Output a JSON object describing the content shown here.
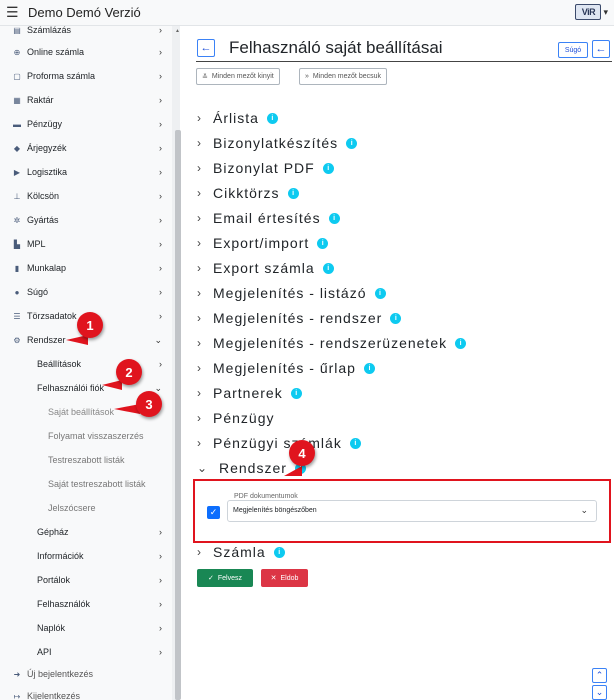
{
  "header": {
    "title": "Demo Demó Verzió",
    "brand": "ViR",
    "menu_icon": "hamburger-icon"
  },
  "sidebar": {
    "items": [
      {
        "label": "Számlázás",
        "icon": "invoice-icon"
      },
      {
        "label": "Online számla",
        "icon": "globe-icon"
      },
      {
        "label": "Proforma számla",
        "icon": "document-icon"
      },
      {
        "label": "Raktár",
        "icon": "warehouse-icon"
      },
      {
        "label": "Pénzügy",
        "icon": "money-icon"
      },
      {
        "label": "Árjegyzék",
        "icon": "tag-icon"
      },
      {
        "label": "Logisztika",
        "icon": "truck-icon"
      },
      {
        "label": "Kölcsön",
        "icon": "lend-icon"
      },
      {
        "label": "Gyártás",
        "icon": "cogs-icon"
      },
      {
        "label": "MPL",
        "icon": "chart-icon"
      },
      {
        "label": "Munkalap",
        "icon": "file-icon"
      },
      {
        "label": "Súgó",
        "icon": "question-icon"
      },
      {
        "label": "Törzsadatok",
        "icon": "database-icon"
      },
      {
        "label": "Rendszer",
        "icon": "settings-icon"
      },
      {
        "label": "Beállítások"
      },
      {
        "label": "Felhasználói fiók"
      },
      {
        "label": "Saját beállítások"
      },
      {
        "label": "Folyamat visszaszerzés"
      },
      {
        "label": "Testreszabott listák"
      },
      {
        "label": "Saját testreszabott listák"
      },
      {
        "label": "Jelszócsere"
      },
      {
        "label": "Gépház"
      },
      {
        "label": "Információk"
      },
      {
        "label": "Portálok"
      },
      {
        "label": "Felhasználók"
      },
      {
        "label": "Naplók"
      },
      {
        "label": "API"
      },
      {
        "label": "Új bejelentkezés",
        "icon": "login-icon"
      },
      {
        "label": "Kijelentkezés",
        "icon": "logout-icon"
      }
    ]
  },
  "main": {
    "title": "Felhasználó saját beállításai",
    "help_label": "Súgó",
    "expand_all": "Minden mezőt kinyit",
    "collapse_all": "Minden mezőt becsuk",
    "sections": [
      {
        "label": "Árlista",
        "info": true
      },
      {
        "label": "Bizonylatkészítés",
        "info": true
      },
      {
        "label": "Bizonylat PDF",
        "info": true
      },
      {
        "label": "Cikktörzs",
        "info": true
      },
      {
        "label": "Email értesítés",
        "info": true
      },
      {
        "label": "Export/import",
        "info": true
      },
      {
        "label": "Export számla",
        "info": true
      },
      {
        "label": "Megjelenítés - listázó",
        "info": true
      },
      {
        "label": "Megjelenítés - rendszer",
        "info": true
      },
      {
        "label": "Megjelenítés - rendszerüzenetek",
        "info": true
      },
      {
        "label": "Megjelenítés - űrlap",
        "info": true
      },
      {
        "label": "Partnerek",
        "info": true
      },
      {
        "label": "Pénzügy",
        "info": false
      },
      {
        "label": "Pénzügyi számlák",
        "info": true
      },
      {
        "label": "Rendszer",
        "info": true,
        "expanded": true
      },
      {
        "label": "Számla",
        "info": true
      }
    ],
    "setting": {
      "legend": "PDF dokumentumok",
      "value": "Megjelenítés böngészőben",
      "checked": true
    },
    "save_label": "Felvesz",
    "drop_label": "Eldob"
  },
  "annotations": {
    "callouts": [
      "1",
      "2",
      "3",
      "4"
    ],
    "color": "#e0141e"
  },
  "colors": {
    "primary": "#0d6efd",
    "info": "#0dcaf0",
    "success": "#198754",
    "danger": "#dc3545"
  }
}
